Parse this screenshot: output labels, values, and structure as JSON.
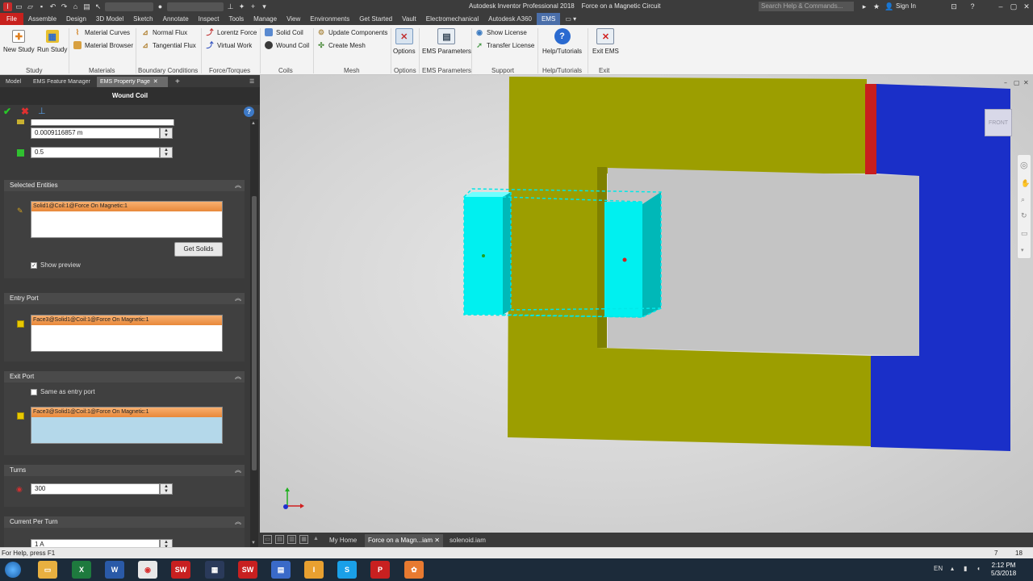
{
  "app": {
    "window_title": "Autodesk Inventor Professional 2018",
    "document_title": "Force on a Magnetic Circuit",
    "search_placeholder": "Search Help & Commands...",
    "sign_in": "Sign In"
  },
  "menu": {
    "tabs": [
      "File",
      "Assemble",
      "Design",
      "3D Model",
      "Sketch",
      "Annotate",
      "Inspect",
      "Tools",
      "Manage",
      "View",
      "Environments",
      "Get Started",
      "Vault",
      "Electromechanical",
      "Autodesk A360",
      "EMS"
    ],
    "active": "EMS"
  },
  "ribbon": {
    "study": {
      "label": "Study",
      "new_study": "New Study",
      "run_study": "Run Study"
    },
    "materials": {
      "label": "Materials",
      "material_curves": "Material Curves",
      "material_browser": "Material Browser"
    },
    "boundary": {
      "label": "Boundary Conditions",
      "normal_flux": "Normal Flux",
      "tangential_flux": "Tangential Flux"
    },
    "force": {
      "label": "Force/Torques",
      "lorentz_force": "Lorentz Force",
      "virtual_work": "Virtual Work"
    },
    "coils": {
      "label": "Coils",
      "solid_coil": "Solid Coil",
      "wound_coil": "Wound Coil"
    },
    "mesh": {
      "label": "Mesh",
      "update_components": "Update Components",
      "create_mesh": "Create Mesh"
    },
    "options": {
      "label": "Options",
      "button": "Options"
    },
    "ems_parameters": {
      "label": "EMS Parameters",
      "button": "EMS Parameters"
    },
    "support": {
      "label": "Support",
      "show_license": "Show License",
      "transfer_license": "Transfer License"
    },
    "help": {
      "label": "Help/Tutorials",
      "button": "Help/Tutorials"
    },
    "exit": {
      "label": "Exit",
      "button": "Exit EMS"
    }
  },
  "panel": {
    "tabs": [
      "Model",
      "EMS Feature Manager",
      "EMS Property Page"
    ],
    "active_tab": "EMS Property Page",
    "title": "Wound Coil",
    "field_wire_size": "0.0009116857 m",
    "field_fill": "0.5",
    "selected_entities": {
      "title": "Selected Entities",
      "item": "Solid1@Coil:1@Force On Magnetic:1",
      "get_solids": "Get Solids",
      "show_preview": "Show preview"
    },
    "entry_port": {
      "title": "Entry Port",
      "item": "Face3@Solid1@Coil:1@Force On Magnetic:1"
    },
    "exit_port": {
      "title": "Exit Port",
      "same_as_entry": "Same as entry port",
      "item": "Face3@Solid1@Coil:1@Force On Magnetic:1"
    },
    "turns": {
      "title": "Turns",
      "value": "300"
    },
    "current": {
      "title": "Current Per Turn",
      "value": "1 A"
    }
  },
  "viewport": {
    "viewcube_label": "FRONT",
    "colors": {
      "core_yellow": "#9c9e00",
      "core_blue": "#1a2fc8",
      "coil_cyan": "#00f0f0",
      "red_band": "#c81e1e"
    }
  },
  "doc_tabs": [
    "My Home",
    "Force on a Magn...iam",
    "solenoid.iam"
  ],
  "doc_tabs_active": "Force on a Magn...iam",
  "status": {
    "help_text": "For Help, press F1",
    "count_a": "7",
    "count_b": "18"
  },
  "taskbar": {
    "language": "EN",
    "time": "2:12 PM",
    "date": "5/3/2018",
    "apps": [
      "explorer",
      "excel",
      "word",
      "chrome",
      "solidworks-2016",
      "calculator",
      "solidworks-2017",
      "word-doc",
      "inventor",
      "skype",
      "pdf",
      "settings"
    ]
  }
}
